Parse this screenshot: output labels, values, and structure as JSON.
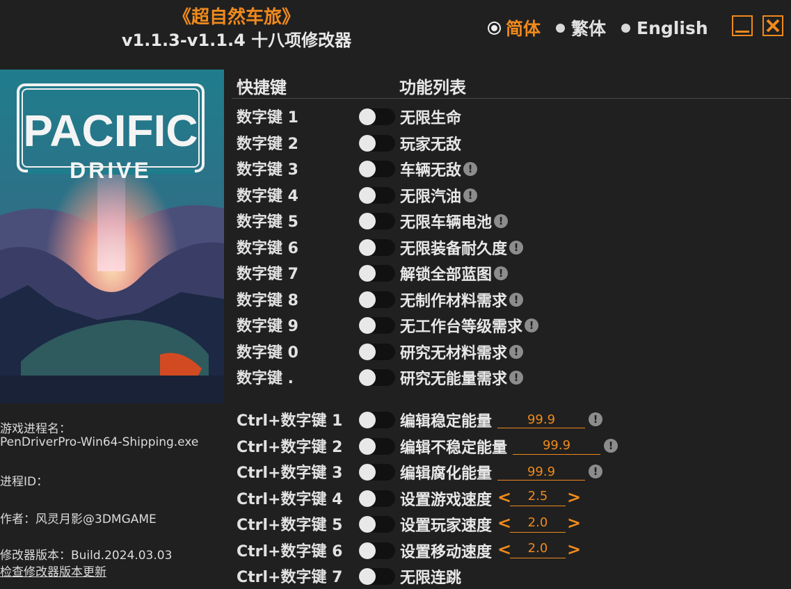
{
  "app": {
    "game_title": "《超自然车旅》",
    "version_title": "v1.1.3-v1.1.4 十八项修改器"
  },
  "languages": [
    {
      "label": "简体",
      "selected": true
    },
    {
      "label": "繁体",
      "selected": false
    },
    {
      "label": "English",
      "selected": false
    }
  ],
  "window_buttons": {
    "minimize": "minimize-icon",
    "close": "close-icon"
  },
  "cover": {
    "logo_line1": "PACIFIC",
    "logo_line2": "DRIVE"
  },
  "info": {
    "process_name_label": "游戏进程名：",
    "process_name": "PenDriverPro-Win64-Shipping.exe",
    "process_id_label": "进程ID：",
    "author": "作者：风灵月影@3DMGAME",
    "trainer_version": "修改器版本：Build.2024.03.03",
    "check_update": "检查修改器版本更新"
  },
  "headers": {
    "hotkey": "快捷键",
    "functions": "功能列表"
  },
  "colors": {
    "accent": "#f08a1c",
    "background": "#202020",
    "toggle_track": "#111111"
  },
  "cheats": [
    {
      "key": "数字键 1",
      "name": "无限生命",
      "warn": false
    },
    {
      "key": "数字键 2",
      "name": "玩家无敌",
      "warn": false
    },
    {
      "key": "数字键 3",
      "name": "车辆无敌",
      "warn": true
    },
    {
      "key": "数字键 4",
      "name": "无限汽油",
      "warn": true
    },
    {
      "key": "数字键 5",
      "name": "无限车辆电池",
      "warn": true
    },
    {
      "key": "数字键 6",
      "name": "无限装备耐久度",
      "warn": true
    },
    {
      "key": "数字键 7",
      "name": "解锁全部蓝图",
      "warn": true
    },
    {
      "key": "数字键 8",
      "name": "无制作材料需求",
      "warn": true
    },
    {
      "key": "数字键 9",
      "name": "无工作台等级需求",
      "warn": true
    },
    {
      "key": "数字键 0",
      "name": "研究无材料需求",
      "warn": true
    },
    {
      "key": "数字键 .",
      "name": "研究无能量需求",
      "warn": true
    }
  ],
  "ctrl_cheats": [
    {
      "key": "Ctrl+数字键 1",
      "name": "编辑稳定能量",
      "type": "input",
      "value": "99.9",
      "warn": true
    },
    {
      "key": "Ctrl+数字键 2",
      "name": "编辑不稳定能量",
      "type": "input",
      "value": "99.9",
      "warn": true
    },
    {
      "key": "Ctrl+数字键 3",
      "name": "编辑腐化能量",
      "type": "input",
      "value": "99.9",
      "warn": true
    },
    {
      "key": "Ctrl+数字键 4",
      "name": "设置游戏速度",
      "type": "stepper",
      "value": "2.5",
      "warn": false
    },
    {
      "key": "Ctrl+数字键 5",
      "name": "设置玩家速度",
      "type": "stepper",
      "value": "2.0",
      "warn": false
    },
    {
      "key": "Ctrl+数字键 6",
      "name": "设置移动速度",
      "type": "stepper",
      "value": "2.0",
      "warn": false
    },
    {
      "key": "Ctrl+数字键 7",
      "name": "无限连跳",
      "type": "toggle",
      "value": "",
      "warn": false
    }
  ],
  "warn_glyph": "!",
  "arrows": {
    "left": "<",
    "right": ">"
  }
}
